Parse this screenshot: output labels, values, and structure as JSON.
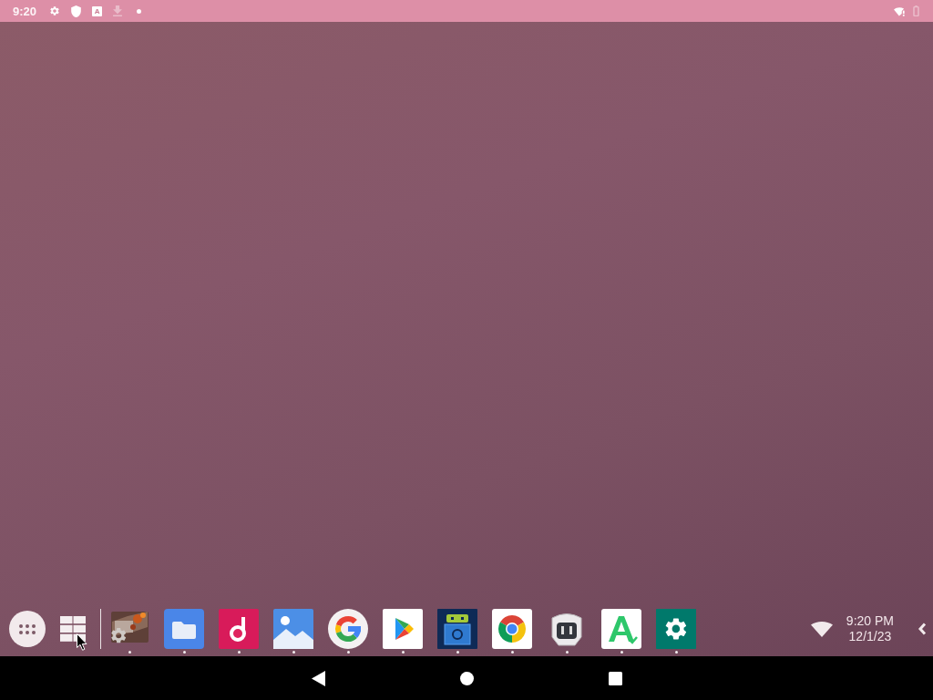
{
  "status_bar": {
    "time": "9:20",
    "input_method": "A"
  },
  "taskbar": {
    "apps": [
      {
        "kind": "game",
        "running": true
      },
      {
        "kind": "files",
        "running": true
      },
      {
        "kind": "music",
        "running": true
      },
      {
        "kind": "gallery",
        "running": true
      },
      {
        "kind": "google",
        "running": true
      },
      {
        "kind": "play_store",
        "running": true
      },
      {
        "kind": "android_tool",
        "running": true
      },
      {
        "kind": "chrome",
        "running": true
      },
      {
        "kind": "code_app",
        "running": true
      },
      {
        "kind": "apk_store",
        "running": true
      },
      {
        "kind": "settings",
        "running": true
      }
    ],
    "clock": {
      "time": "9:20 PM",
      "date": "12/1/23"
    }
  }
}
